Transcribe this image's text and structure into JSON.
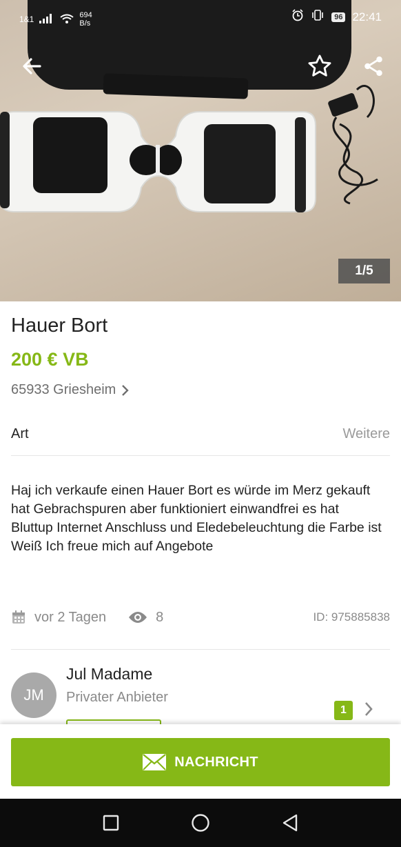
{
  "status_bar": {
    "carrier": "1&1",
    "net_speed_value": "694",
    "net_speed_unit": "B/s",
    "battery": "96",
    "time": "22:41"
  },
  "gallery": {
    "counter": "1/5"
  },
  "listing": {
    "title": "Hauer Bort",
    "price": "200 € VB",
    "location": "65933 Griesheim",
    "attribute_label": "Art",
    "attribute_value": "Weitere",
    "description": "Haj ich verkaufe einen Hauer Bort es würde im Merz gekauft hat Gebrachspuren aber funktioniert einwandfrei es hat Bluttup Internet Anschluss und Eledebeleuchtung die Farbe ist Weiß Ich freue mich auf Angebote",
    "posted": "vor 2 Tagen",
    "views": "8",
    "id": "ID: 975885838"
  },
  "seller": {
    "initials": "JM",
    "name": "Jul Madame",
    "type": "Privater Anbieter",
    "badge_count": "1"
  },
  "actions": {
    "message_label": "NACHRICHT"
  },
  "icons": {
    "back": "back-arrow-icon",
    "favorite": "star-icon",
    "share": "share-icon",
    "calendar": "calendar-icon",
    "views": "eye-icon",
    "mail": "mail-icon",
    "nav_recents": "square-icon",
    "nav_home": "circle-icon",
    "nav_back": "triangle-back-icon"
  },
  "colors": {
    "brand_green": "#86b817",
    "muted_text": "#8a8a8a",
    "navbar": "#0c0c0c"
  }
}
